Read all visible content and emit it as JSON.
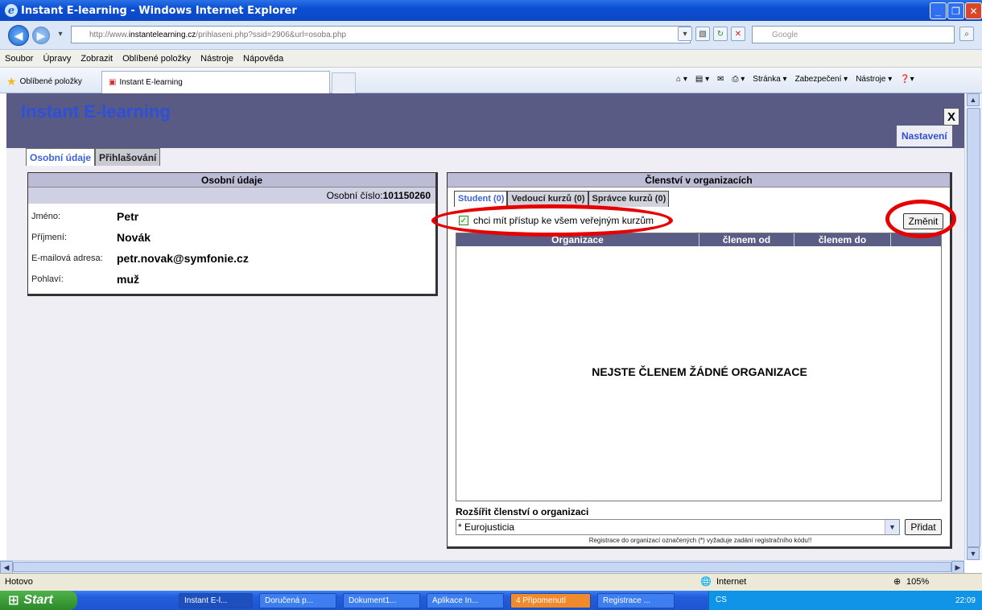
{
  "window": {
    "title": "Instant E-learning - Windows Internet Explorer"
  },
  "address": {
    "url_prefix": "http://www.",
    "url_domain": "instantelearning.cz",
    "url_path": "/prihlaseni.php?ssid=2906&url=osoba.php",
    "search_placeholder": "Google"
  },
  "menu": [
    "Soubor",
    "Úpravy",
    "Zobrazit",
    "Oblíbené položky",
    "Nástroje",
    "Nápověda"
  ],
  "favorites": {
    "label": "Oblíbené položky",
    "tab_title": "Instant E-learning",
    "commands": [
      "Stránka ▾",
      "Zabezpečení ▾",
      "Nástroje ▾"
    ]
  },
  "page": {
    "brand": "Instant E-learning",
    "close_label": "X",
    "settings_link": "Nastavení",
    "tabs": [
      "Osobní údaje",
      "Přihlašování"
    ],
    "personal": {
      "header": "Osobní údaje",
      "number_label": "Osobní číslo:",
      "number_value": "101150260",
      "rows": [
        {
          "label": "Jméno:",
          "value": "Petr"
        },
        {
          "label": "Příjmení:",
          "value": "Novák"
        },
        {
          "label": "E-mailová adresa:",
          "value": "petr.novak@symfonie.cz"
        },
        {
          "label": "Pohlaví:",
          "value": "muž"
        }
      ]
    },
    "membership": {
      "header": "Členství v organizacích",
      "tabs": [
        "Student (0)",
        "Vedoucí kurzů (0)",
        "Správce kurzů (0)"
      ],
      "checkbox_label": "chci mít přístup ke všem veřejným kurzům",
      "checkbox_checked": true,
      "change_button": "Změnit",
      "columns": [
        "Organizace",
        "členem od",
        "členem do"
      ],
      "empty_message": "NEJSTE ČLENEM ŽÁDNÉ ORGANIZACE",
      "extend_label": "Rozšířit členství o organizaci",
      "select_value": "* Eurojusticia",
      "add_button": "Přidat",
      "note": "Registrace do organizací označených (*) vyžaduje zadání registračního kódu!!"
    }
  },
  "status": {
    "left": "Hotovo",
    "zone": "Internet",
    "zoom": "105%"
  },
  "taskbar": {
    "start": "Start",
    "tasks": [
      "Instant E-l...",
      "Doručená p...",
      "Dokument1...",
      "Aplikace In...",
      "4 Připomenutí",
      "Registrace ..."
    ],
    "lang": "CS",
    "clock": "22:09"
  },
  "colors": {
    "accent_blue": "#2e50d8",
    "header_bg": "#595b85",
    "annotation_red": "#e60000"
  }
}
